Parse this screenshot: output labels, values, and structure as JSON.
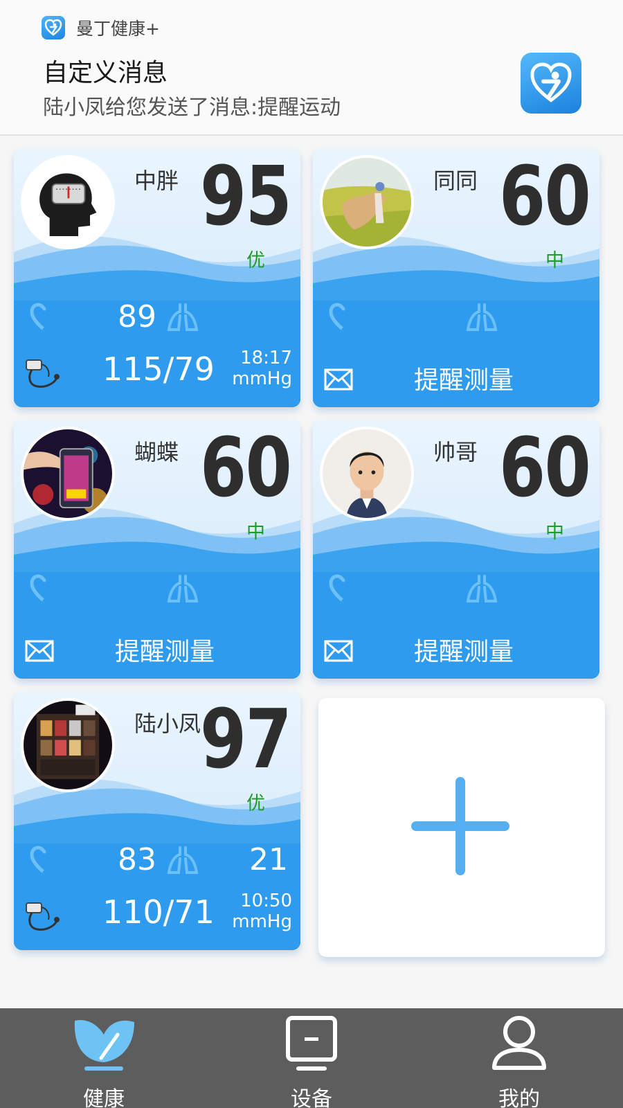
{
  "notification": {
    "app_name": "曼丁健康+",
    "title": "自定义消息",
    "body": "陆小凤给您发送了消息:提醒运动"
  },
  "cards": [
    {
      "name": "中胖",
      "score": "95",
      "grade": "优",
      "heart_rate": "89",
      "respiration": "",
      "blood_pressure": "115/79",
      "time": "18:17",
      "unit": "mmHg",
      "mode": "data"
    },
    {
      "name": "同同",
      "score": "60",
      "grade": "中",
      "remind_label": "提醒测量",
      "mode": "remind"
    },
    {
      "name": "蝴蝶",
      "score": "60",
      "grade": "中",
      "remind_label": "提醒测量",
      "mode": "remind"
    },
    {
      "name": "帅哥",
      "score": "60",
      "grade": "中",
      "remind_label": "提醒测量",
      "mode": "remind"
    },
    {
      "name": "陆小凤",
      "score": "97",
      "grade": "优",
      "heart_rate": "83",
      "respiration": "21",
      "blood_pressure": "110/71",
      "time": "10:50",
      "unit": "mmHg",
      "mode": "data"
    }
  ],
  "add_card": {
    "icon": "plus-icon"
  },
  "nav": [
    {
      "label": "健康",
      "icon": "health-leaf-icon",
      "active": true
    },
    {
      "label": "设备",
      "icon": "device-icon",
      "active": false
    },
    {
      "label": "我的",
      "icon": "profile-icon",
      "active": false
    }
  ],
  "colors": {
    "accent": "#2f9ff0",
    "grade_green": "#1f9a2c",
    "nav_bg": "#5d5d5d",
    "nav_active": "#6ec3f5"
  }
}
